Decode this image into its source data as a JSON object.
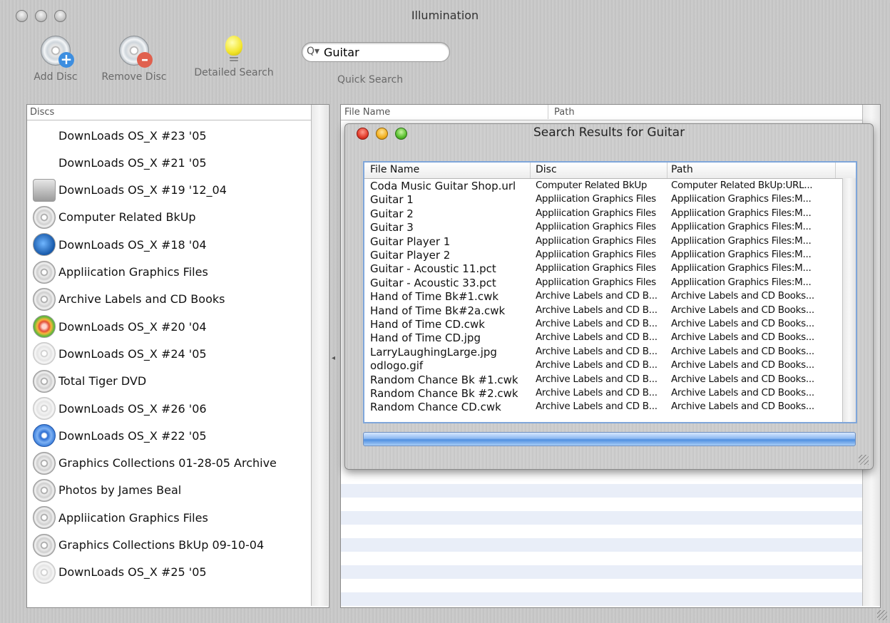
{
  "window": {
    "title": "Illumination"
  },
  "toolbar": {
    "add_disc": "Add Disc",
    "remove_disc": "Remove Disc",
    "detailed_search": "Detailed Search",
    "quick_search": "Quick Search",
    "search_value": "Guitar"
  },
  "discs": {
    "header": "Discs",
    "items": [
      {
        "label": "DownLoads OS_X  #23  '05",
        "icon": "none"
      },
      {
        "label": "DownLoads OS_X  #21  '05",
        "icon": "none"
      },
      {
        "label": "DownLoads OS_X  #19  '12_04",
        "icon": "hard-drive-icon"
      },
      {
        "label": "Computer Related BkUp",
        "icon": "dvd-icon"
      },
      {
        "label": "DownLoads OS_X  #18  '04",
        "icon": "globe-icon"
      },
      {
        "label": "Appliication Graphics Files",
        "icon": "cd-icon"
      },
      {
        "label": "Archive Labels and CD Books",
        "icon": "dvd-icon"
      },
      {
        "label": "DownLoads OS_X  #20  '04",
        "icon": "apple-icon"
      },
      {
        "label": "DownLoads OS_X  #24  '05",
        "icon": "faint-disc-icon"
      },
      {
        "label": "Total Tiger DVD",
        "icon": "dvd-icon"
      },
      {
        "label": "DownLoads OS_X  #26  '06",
        "icon": "faint-disc-icon"
      },
      {
        "label": "DownLoads OS_X  #22  '05",
        "icon": "blue-disc-icon"
      },
      {
        "label": "Graphics Collections 01-28-05 Archive",
        "icon": "cd-icon"
      },
      {
        "label": "Photos by James Beal",
        "icon": "cd-icon"
      },
      {
        "label": "Appliication Graphics Files",
        "icon": "cd-icon"
      },
      {
        "label": "Graphics Collections BkUp 09-10-04",
        "icon": "cd-icon"
      },
      {
        "label": "DownLoads OS_X  #25  '05",
        "icon": "faint-disc-icon"
      }
    ]
  },
  "main_table": {
    "col_file": "File Name",
    "col_path": "Path"
  },
  "search_sheet": {
    "title": "Search Results for Guitar",
    "columns": [
      "File Name",
      "Disc",
      "Path"
    ],
    "rows": [
      [
        "Coda Music Guitar Shop.url",
        "Computer Related BkUp",
        "Computer Related BkUp:URL..."
      ],
      [
        "Guitar 1",
        "Appliication Graphics Files",
        "Appliication Graphics Files:M..."
      ],
      [
        "Guitar 2",
        "Appliication Graphics Files",
        "Appliication Graphics Files:M..."
      ],
      [
        "Guitar 3",
        "Appliication Graphics Files",
        "Appliication Graphics Files:M..."
      ],
      [
        "Guitar Player 1",
        "Appliication Graphics Files",
        "Appliication Graphics Files:M..."
      ],
      [
        "Guitar Player 2",
        "Appliication Graphics Files",
        "Appliication Graphics Files:M..."
      ],
      [
        "Guitar - Acoustic 11.pct",
        "Appliication Graphics Files",
        "Appliication Graphics Files:M..."
      ],
      [
        "Guitar - Acoustic 33.pct",
        "Appliication Graphics Files",
        "Appliication Graphics Files:M..."
      ],
      [
        "Hand of Time Bk#1.cwk",
        "Archive Labels and CD B...",
        "Archive Labels and CD Books..."
      ],
      [
        "Hand of Time Bk#2a.cwk",
        "Archive Labels and CD B...",
        "Archive Labels and CD Books..."
      ],
      [
        "Hand of Time CD.cwk",
        "Archive Labels and CD B...",
        "Archive Labels and CD Books..."
      ],
      [
        "Hand of Time CD.jpg",
        "Archive Labels and CD B...",
        "Archive Labels and CD Books..."
      ],
      [
        "LarryLaughingLarge.jpg",
        "Archive Labels and CD B...",
        "Archive Labels and CD Books..."
      ],
      [
        "odlogo.gif",
        "Archive Labels and CD B...",
        "Archive Labels and CD Books..."
      ],
      [
        "Random Chance Bk #1.cwk",
        "Archive Labels and CD B...",
        "Archive Labels and CD Books..."
      ],
      [
        "Random Chance Bk #2.cwk",
        "Archive Labels and CD B...",
        "Archive Labels and CD Books..."
      ],
      [
        "Random Chance CD.cwk",
        "Archive Labels and CD B...",
        "Archive Labels and CD Books..."
      ]
    ]
  }
}
